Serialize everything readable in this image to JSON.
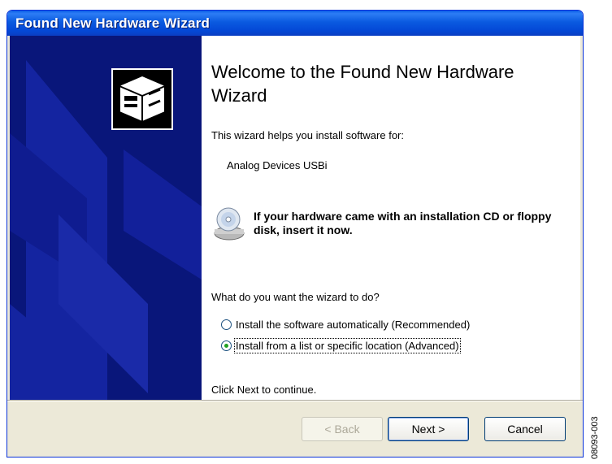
{
  "window": {
    "title": "Found New Hardware Wizard"
  },
  "sidebar": {
    "icon": "hardware-box-icon"
  },
  "main": {
    "heading": "Welcome to the Found New Hardware Wizard",
    "intro": "This wizard helps you install software for:",
    "device_name": "Analog Devices USBi",
    "cd_icon": "cd-disk-icon",
    "cd_message": "If your hardware came with an installation CD or floppy disk, insert it now.",
    "question": "What do you want the wizard to do?",
    "options": [
      {
        "label": "Install the software automatically (Recommended)",
        "selected": false
      },
      {
        "label": "Install from a list or specific location (Advanced)",
        "selected": true
      }
    ],
    "continue_text": "Click Next to continue."
  },
  "buttons": {
    "back_label": "< Back",
    "next_label": "Next >",
    "cancel_label": "Cancel"
  },
  "figure_code": "08093-003"
}
